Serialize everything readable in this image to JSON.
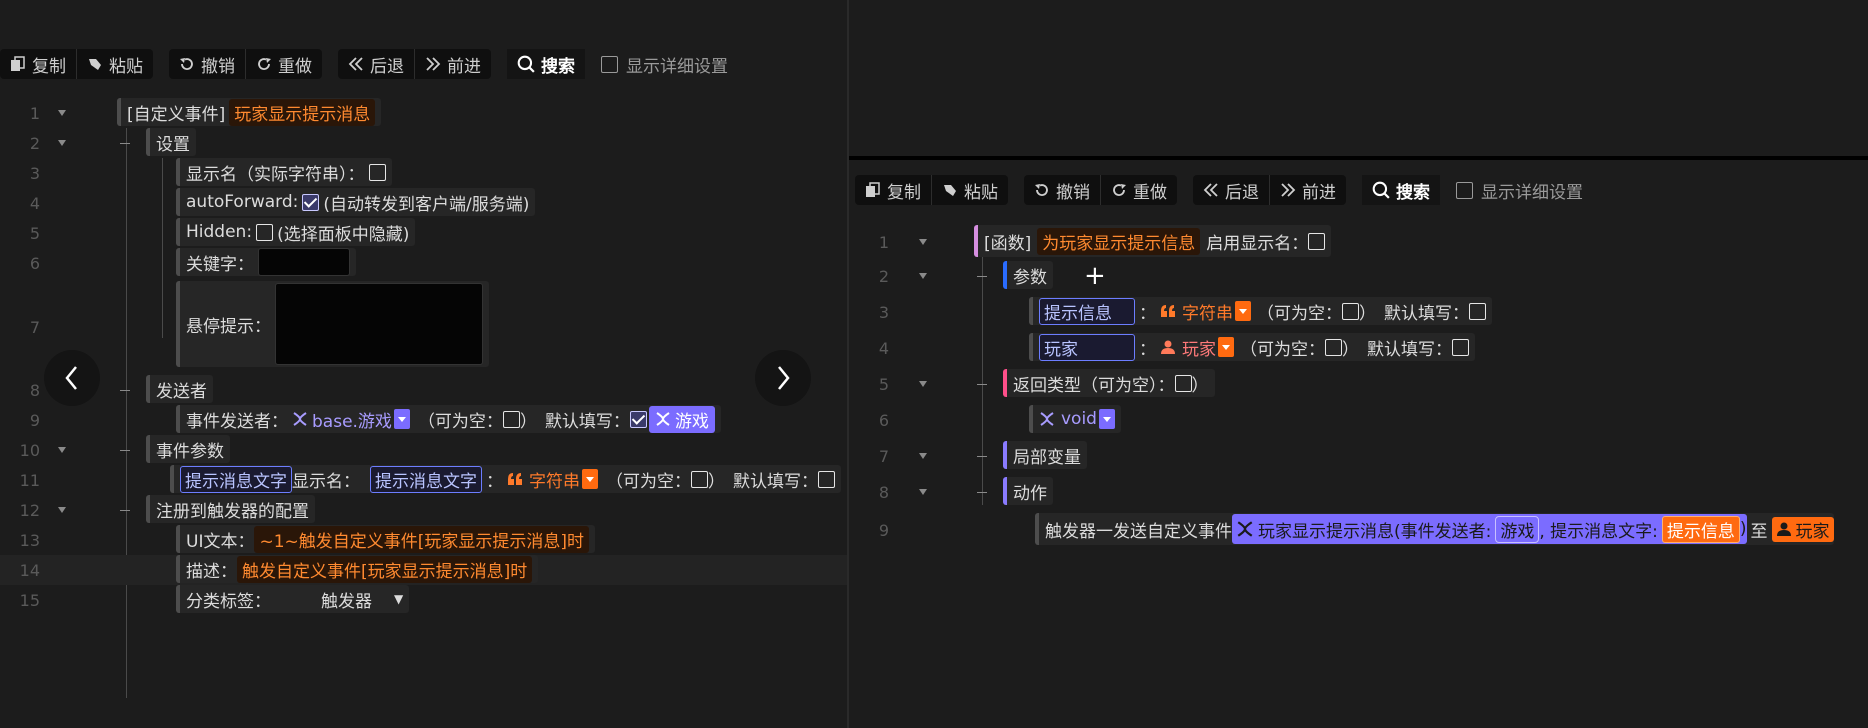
{
  "toolbar": {
    "copy": "复制",
    "paste": "粘贴",
    "undo": "撤销",
    "redo": "重做",
    "back": "后退",
    "forward": "前进",
    "search": "搜索",
    "detail": "显示详细设置"
  },
  "left": {
    "lines": [
      "1",
      "2",
      "3",
      "4",
      "5",
      "6",
      "7",
      "8",
      "9",
      "10",
      "11",
      "12",
      "13",
      "14",
      "15"
    ],
    "event_prefix": "[自定义事件]",
    "event_name": "玩家显示提示消息",
    "settings": "设置",
    "display_name_label": "显示名（实际字符串）：",
    "autoforward_label": "autoForward:",
    "autoforward_desc": "(自动转发到客户端/服务端)",
    "hidden_label": "Hidden:",
    "hidden_desc": "(选择面板中隐藏)",
    "keyword_label": "关键字：",
    "tooltip_label": "悬停提示：",
    "sender": "发送者",
    "sender_label": "事件发送者：",
    "sender_type": "base.游戏",
    "nullable": "（可为空：",
    "close_paren": "）",
    "default_fill": "默认填写：",
    "sender_default": "游戏",
    "params": "事件参数",
    "param_name": "提示消息文字",
    "display_name": "显示名：",
    "param_display": "提示消息文字",
    "colon": "：",
    "string_type": "字符串",
    "register": "注册到触发器的配置",
    "ui_text_label": "UI文本：",
    "ui_text": "~1~触发自定义事件[玩家显示提示消息]时",
    "desc_label": "描述：",
    "desc": "触发自定义事件[玩家显示提示消息]时",
    "category_label": "分类标签：",
    "category": "触发器"
  },
  "right": {
    "lines": [
      "1",
      "2",
      "3",
      "4",
      "5",
      "6",
      "7",
      "8",
      "9"
    ],
    "func_prefix": "[函数]",
    "func_name": "为玩家显示提示信息",
    "enable_display": "启用显示名：",
    "params": "参数",
    "plus": "+",
    "p1_name": "提示信息",
    "colon": "：",
    "p1_type": "字符串",
    "nullable": "（可为空：",
    "close_paren": "）",
    "default_fill": "默认填写：",
    "p2_name": "玩家",
    "p2_type": "玩家",
    "return_type": "返回类型（可为空）：",
    "void": "void",
    "locals": "局部变量",
    "actions": "动作",
    "action_prefix": "触发器一发送自定义事件",
    "action_call": "玩家显示提示消息(事件发送者:",
    "action_arg1": "游戏",
    "action_mid": ", 提示消息文字:",
    "action_arg2": "提示信息",
    "action_close": ")",
    "action_to": "至",
    "action_target": "玩家"
  }
}
